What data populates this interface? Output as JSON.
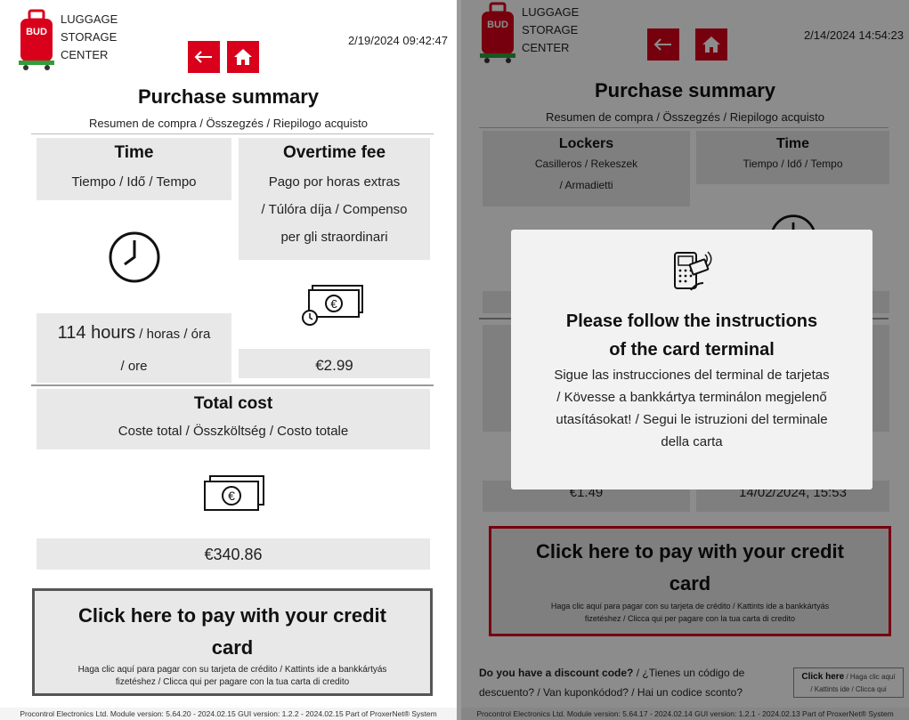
{
  "brand": {
    "line1": "LUGGAGE",
    "line2": "STORAGE",
    "line3": "CENTER",
    "badge": "BUD"
  },
  "left": {
    "datetime": "2/19/2024 09:42:47",
    "title": "Purchase summary",
    "subtitle": "Resumen de compra / Összegzés / Riepilogo acquisto",
    "time_card": {
      "title": "Time",
      "sub": "Tiempo  / Idő  / Tempo",
      "value_main": "114 hours",
      "value_rest": " / horas  / óra",
      "value_rest2": "/ ore",
      "icon": "clock-icon"
    },
    "overtime_card": {
      "title": "Overtime fee",
      "sub1": "Pago por horas extras",
      "sub2": "/ Túlóra díja  / Compenso",
      "sub3": "per gli straordinari",
      "value": "€2.99",
      "icon": "overtime-money-icon"
    },
    "total_card": {
      "title": "Total cost",
      "sub": "Coste total  / Összköltség  / Costo totale",
      "value": "€340.86",
      "icon": "money-icon"
    },
    "pay": {
      "title1": "Click here to pay with your credit",
      "title2": "card",
      "sub1": "Haga clic aquí para pagar con su tarjeta de crédito  / Kattints ide a bankkártyás",
      "sub2": "fizetéshez  / Clicca qui per pagare con la tua carta di credito"
    },
    "footer": "Procontrol Electronics Ltd.  Module version: 5.64.20 - 2024.02.15 GUI version: 1.2.2 - 2024.02.15  Part of ProxerNet® System"
  },
  "right": {
    "datetime": "2/14/2024 14:54:23",
    "title": "Purchase summary",
    "subtitle": "Resumen de compra / Összegzés / Riepilogo acquisto",
    "lockers_card": {
      "title": "Lockers",
      "sub1": "Casilleros  / Rekeszek",
      "sub2": "/ Armadietti",
      "value": "€1.49"
    },
    "time_card": {
      "title": "Time",
      "sub": "Tiempo  / Idő  / Tempo",
      "value": "14/02/2024, 15:53"
    },
    "modal": {
      "title1": "Please follow the instructions",
      "title2": "of the card terminal",
      "sub1": "Sigue las instrucciones del terminal de tarjetas",
      "sub2": "/ Kövesse a bankkártya terminálon megjelenő",
      "sub3": "utasításokat!  / Segui le istruzioni del terminale",
      "sub4": "della carta",
      "icon": "card-terminal-icon"
    },
    "pay": {
      "title1": "Click here to pay with your credit",
      "title2": "card",
      "sub1": "Haga clic aquí para pagar con su tarjeta de crédito  / Kattints ide a bankkártyás",
      "sub2": "fizetéshez  / Clicca qui per pagare con la tua carta di credito"
    },
    "discount": {
      "question": "Do you have a discount code?",
      "rest1": " / ¿Tienes un código de",
      "rest2": "descuento?  / Van kuponkódod?  / Hai un codice sconto?",
      "btn_main": "Click here",
      "btn_rest1": " / Haga clic aquí",
      "btn_rest2": "/ Kattints ide  / Clicca qui"
    },
    "footer": "Procontrol Electronics Ltd.  Module version: 5.64.17 - 2024.02.14 GUI version: 1.2.1 - 2024.02.13  Part of ProxerNet® System"
  },
  "colors": {
    "accent": "#d9001b",
    "card": "#e8e8e8"
  }
}
